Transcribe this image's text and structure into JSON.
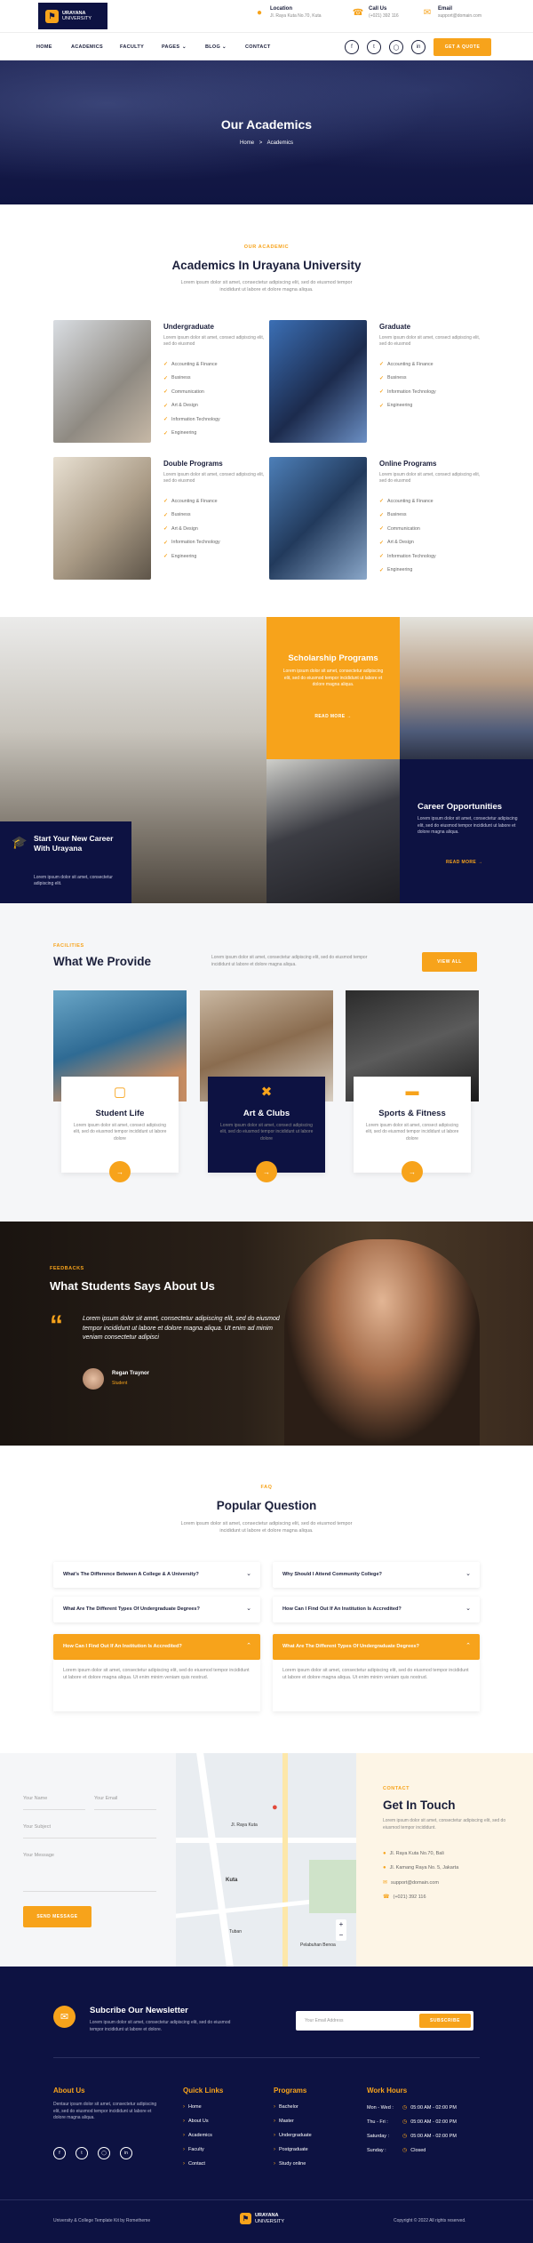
{
  "brand": {
    "name": "URAYANA",
    "tagline": "UNIVERSITY"
  },
  "header_contacts": [
    {
      "icon": "pin-icon",
      "title": "Location",
      "text": "Jl. Raya Kuta No.70, Kuta"
    },
    {
      "icon": "phone-icon",
      "title": "Call Us",
      "text": "(+021) 392 116"
    },
    {
      "icon": "mail-icon",
      "title": "Email",
      "text": "support@domain.com"
    }
  ],
  "nav": {
    "items": [
      "HOME",
      "ACADEMICS",
      "FACULTY",
      "PAGES",
      "BLOG",
      "CONTACT"
    ],
    "active": "ACADEMICS",
    "cta": "GET A QUOTE"
  },
  "social_icons": [
    "facebook-icon",
    "twitter-icon",
    "instagram-icon",
    "linkedin-icon"
  ],
  "hero": {
    "title": "Our Academics",
    "breadcrumb_home": "Home",
    "breadcrumb_sep": ">",
    "breadcrumb_current": "Academics"
  },
  "academics": {
    "eyebrow": "OUR ACADEMIC",
    "title": "Academics In Urayana University",
    "subtitle": "Lorem ipsum dolor sit amet, consectetur adipiscing elit, sed do eiusmod tempor incididunt ut labore et dolore magna aliqua.",
    "cards": [
      {
        "title": "Undergraduate",
        "desc": "Lorem ipsum dolor sit amet, consect adipiscing elit, sed do eiusmod",
        "items": [
          "Accounting & Finance",
          "Business",
          "Communication",
          "Art & Design",
          "Information Technology",
          "Engineering"
        ]
      },
      {
        "title": "Graduate",
        "desc": "Lorem ipsum dolor sit amet, consect adipiscing elit, sed do eiusmod",
        "items": [
          "Accounting & Finance",
          "Business",
          "Information Technology",
          "Engineering"
        ]
      },
      {
        "title": "Double Programs",
        "desc": "Lorem ipsum dolor sit amet, consect adipiscing elit, sed do eiusmod",
        "items": [
          "Accounting & Finance",
          "Business",
          "Art & Design",
          "Information Technology",
          "Engineering"
        ]
      },
      {
        "title": "Online Programs",
        "desc": "Lorem ipsum dolor sit amet, consect adipiscing elit, sed do eiusmod",
        "items": [
          "Accounting & Finance",
          "Business",
          "Communication",
          "Art & Design",
          "Information Technology",
          "Engineering"
        ]
      }
    ]
  },
  "programs": {
    "career_box": {
      "title": "Start Your New Career With Urayana",
      "text": "Lorem ipsum dolor sit amet, consectetur adipiscing elit."
    },
    "scholarship": {
      "title": "Scholarship Programs",
      "text": "Lorem ipsum dolor sit amet, consectetur adipiscing elit, sed do eiusmod tempor incididunt ut labore et dolore magna aliqua.",
      "link": "READ MORE"
    },
    "opportunities": {
      "title": "Career Opportunities",
      "text": "Lorem ipsum dolor sit amet, consectetur adipiscing elit, sed do eiusmod tempor incididunt ut labore et dolore magna aliqua.",
      "link": "READ MORE"
    }
  },
  "provide": {
    "eyebrow": "FACILITIES",
    "title": "What We Provide",
    "text": "Lorem ipsum dolor sit amet, consectetur adipiscing elit, sed do eiusmod tempor incididunt ut labore et dolore magna aliqua.",
    "button": "VIEW ALL",
    "cards": [
      {
        "title": "Student Life",
        "desc": "Lorem ipsum dolor sit amet, consect adipiscing elit, sed do eiusmod tempor incididunt ut labore dolore"
      },
      {
        "title": "Art & Clubs",
        "desc": "Lorem ipsum dolor sit amet, consect adipiscing elit, sed do eiusmod tempor incididunt ut labore dolore"
      },
      {
        "title": "Sports & Fitness",
        "desc": "Lorem ipsum dolor sit amet, consect adipiscing elit, sed do eiusmod tempor incididunt ut labore dolore"
      }
    ]
  },
  "testimonial": {
    "eyebrow": "FEEDBACKS",
    "title": "What Students Says About Us",
    "quote": "Lorem ipsum dolor sit amet, consectetur adipiscing elit, sed do eiusmod tempor incididunt ut labore et dolore magna aliqua. Ut enim ad minim veniam consectetur adipisci",
    "name": "Regan Traynor",
    "role": "Student"
  },
  "faq": {
    "eyebrow": "FAQ",
    "title": "Popular Question",
    "subtitle": "Lorem ipsum dolor sit amet, consectetur adipiscing elit, sed do eiusmod tempor incididunt ut labore et dolore magna aliqua.",
    "left": [
      "What's The Difference Between A College & A University?",
      "What Are The Different Types Of Undergraduate Degrees?",
      "How Can I Find Out If An Institution Is Accredited?"
    ],
    "right": [
      "Why Should I Attend Community College?",
      "How Can I Find Out If An Institution Is Accredited?",
      "What Are The Different Types Of Undergraduate Degrees?"
    ],
    "answer": "Lorem ipsum dolor sit amet, consectetur adipiscing elit, sed do eiusmod tempor incididunt ut labore et dolore magna aliqua. Ut enim minim veniam quis nostrud."
  },
  "contact_form": {
    "name": "Your Name",
    "email": "Your Email",
    "subject": "Your Subject",
    "message": "Your Message",
    "button": "SEND MESSAGE"
  },
  "map": {
    "labels": [
      "Jl. Raya Kuta",
      "Kuta",
      "Tuban",
      "Pelabuhan Benoa"
    ]
  },
  "get_in_touch": {
    "eyebrow": "CONTACT",
    "title": "Get In Touch",
    "text": "Lorem ipsum dolor sit amet, consectetur adipiscing elit, sed do eiusmod tempor incididunt.",
    "items": [
      "Jl. Raya Kuta No.70, Bali",
      "Jl. Kamang Raya No. 5, Jakarta",
      "support@domain.com",
      "(+021) 392 116"
    ]
  },
  "newsletter": {
    "title": "Subcribe Our Newsletter",
    "text": "Lorem ipsum dolor sit amet, consectetur adipiscing elit, sed do eiusmod tempor incididunt ut labore et dolore.",
    "placeholder": "Your Email Address",
    "button": "SUBSCRIBE"
  },
  "footer": {
    "about_title": "About Us",
    "about_text": "Dentaur ipsum dolor sit amet, consectetur adipiscing elit, sed do eiusmod tempor incididunt ut labore et dolore magna aliqua.",
    "quick_title": "Quick Links",
    "quick": [
      "Home",
      "About Us",
      "Academics",
      "Faculty",
      "Contact"
    ],
    "prog_title": "Programs",
    "programs": [
      "Bachelor",
      "Master",
      "Undergraduate",
      "Postgraduate",
      "Study online"
    ],
    "hours_title": "Work Hours",
    "hours": [
      {
        "day": "Mon - Wed :",
        "time": "05:00 AM - 02:00 PM"
      },
      {
        "day": "Thu - Fri :",
        "time": "05:00 AM - 02:00 PM"
      },
      {
        "day": "Saturday :",
        "time": "05:00 AM - 02:00 PM"
      },
      {
        "day": "Sunday :",
        "time": "Closed"
      }
    ],
    "credit": "University & College Template Kit by Rometheme",
    "copyright": "Copyright © 2022 All rights reserved."
  },
  "colors": {
    "navy": "#0d1242",
    "orange": "#f7a31b"
  }
}
